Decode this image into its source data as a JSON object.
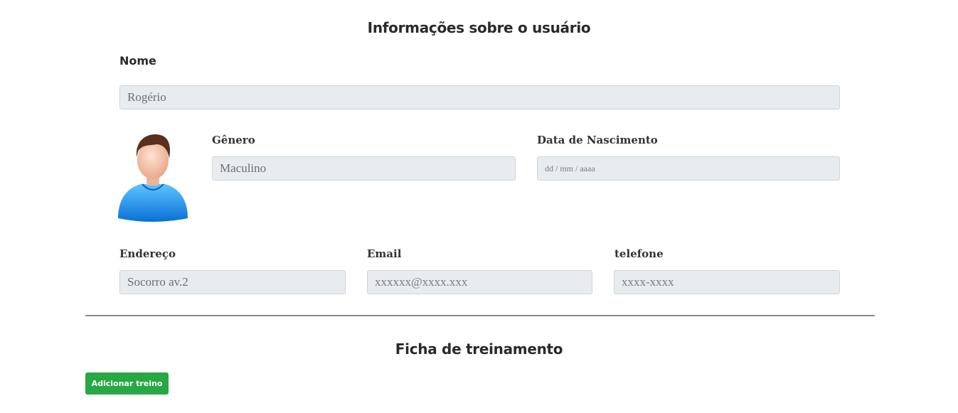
{
  "user_section": {
    "title": "Informações sobre o usuário",
    "name": {
      "label": "Nome",
      "value": "Rogério"
    },
    "gender": {
      "label": "Gênero",
      "value": "Maculino"
    },
    "birthdate": {
      "label": "Data de Nascimento",
      "placeholder": "dd / mm / aaaa"
    },
    "address": {
      "label": "Endereço",
      "value": "Socorro av.2"
    },
    "email": {
      "label": "Email",
      "placeholder": "xxxxxx@xxxx.xxx"
    },
    "phone": {
      "label": "telefone",
      "placeholder": "xxxx-xxxx"
    },
    "avatar_icon": "user-avatar-icon"
  },
  "training_section": {
    "title": "Ficha de treinamento",
    "add_button_label": "Adicionar treino",
    "button_color": "#28a745"
  }
}
